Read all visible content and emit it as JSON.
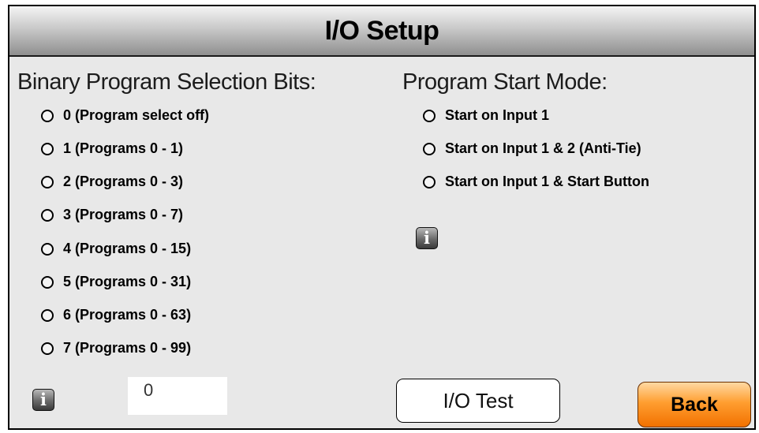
{
  "window": {
    "title": "I/O Setup"
  },
  "binary_section": {
    "heading": "Binary Program Selection Bits:",
    "options": [
      "0 (Program select off)",
      "1 (Programs 0 - 1)",
      "2 (Programs 0 - 3)",
      "3 (Programs 0 - 7)",
      "4 (Programs 0 - 15)",
      "5 (Programs 0 - 31)",
      "6 (Programs 0 - 63)",
      "7 (Programs 0 - 99)"
    ],
    "value": "0"
  },
  "start_section": {
    "heading": "Program Start Mode:",
    "options": [
      "Start on Input 1",
      "Start on Input 1 & 2 (Anti-Tie)",
      "Start on Input 1 & Start Button"
    ]
  },
  "info_icon_label": "i",
  "buttons": {
    "io_test": "I/O Test",
    "back": "Back"
  },
  "colors": {
    "back_button": "#ff8a1a",
    "panel_background": "#e8e8e8"
  }
}
